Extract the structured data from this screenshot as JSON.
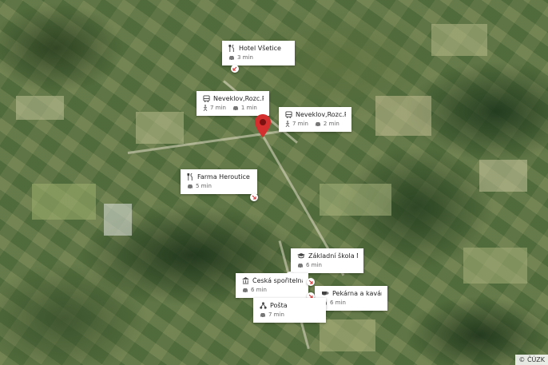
{
  "map": {
    "attribution": "© ČÚZK",
    "pin_color": "#d32f2f"
  },
  "places": [
    {
      "name": "Hotel Všetice",
      "icon": "restaurant-icon",
      "car": "3 min"
    },
    {
      "name": "Neveklov,Rozc.Pr...",
      "icon": "bus-icon",
      "walk": "7 min",
      "car": "1 min"
    },
    {
      "name": "Neveklov,Rozc.Pr...",
      "icon": "bus-icon",
      "walk": "7 min",
      "car": "2 min"
    },
    {
      "name": "Farma Heroutice",
      "icon": "restaurant-icon",
      "car": "5 min"
    },
    {
      "name": "Základní škola N...",
      "icon": "school-icon",
      "car": "6 min"
    },
    {
      "name": "Česká spořitelna",
      "icon": "bank-icon",
      "car": "6 min"
    },
    {
      "name": "Pekárna a kavárn...",
      "icon": "cafe-icon",
      "car": "6 min"
    },
    {
      "name": "Pošta",
      "icon": "post-office-icon",
      "car": "7 min"
    }
  ]
}
